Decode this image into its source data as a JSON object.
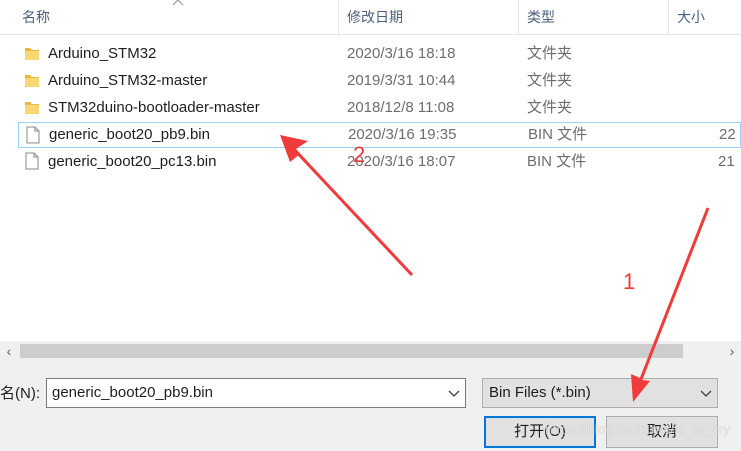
{
  "header": {
    "col_name": "名称",
    "col_date": "修改日期",
    "col_type": "类型",
    "col_size": "大小"
  },
  "files": [
    {
      "name": "Arduino_STM32",
      "date": "2020/3/16 18:18",
      "type": "文件夹",
      "size": "",
      "icon": "folder-icon"
    },
    {
      "name": "Arduino_STM32-master",
      "date": "2019/3/31 10:44",
      "type": "文件夹",
      "size": "",
      "icon": "folder-icon"
    },
    {
      "name": "STM32duino-bootloader-master",
      "date": "2018/12/8 11:08",
      "type": "文件夹",
      "size": "",
      "icon": "folder-icon"
    },
    {
      "name": "generic_boot20_pb9.bin",
      "date": "2020/3/16 19:35",
      "type": "BIN 文件",
      "size": "22",
      "icon": "file-icon"
    },
    {
      "name": "generic_boot20_pc13.bin",
      "date": "2020/3/16 18:07",
      "type": "BIN 文件",
      "size": "21",
      "icon": "file-icon"
    }
  ],
  "footer": {
    "filename_label": "名(N):",
    "filename_value": "generic_boot20_pb9.bin",
    "filetype_value": "Bin Files (*.bin)",
    "open_label": "打开(O)",
    "cancel_label": "取消"
  },
  "annotations": {
    "label_1": "1",
    "label_2": "2",
    "color": "#ef3b3b"
  },
  "watermark": "https://blog.csdn.net/lc_to_cry"
}
